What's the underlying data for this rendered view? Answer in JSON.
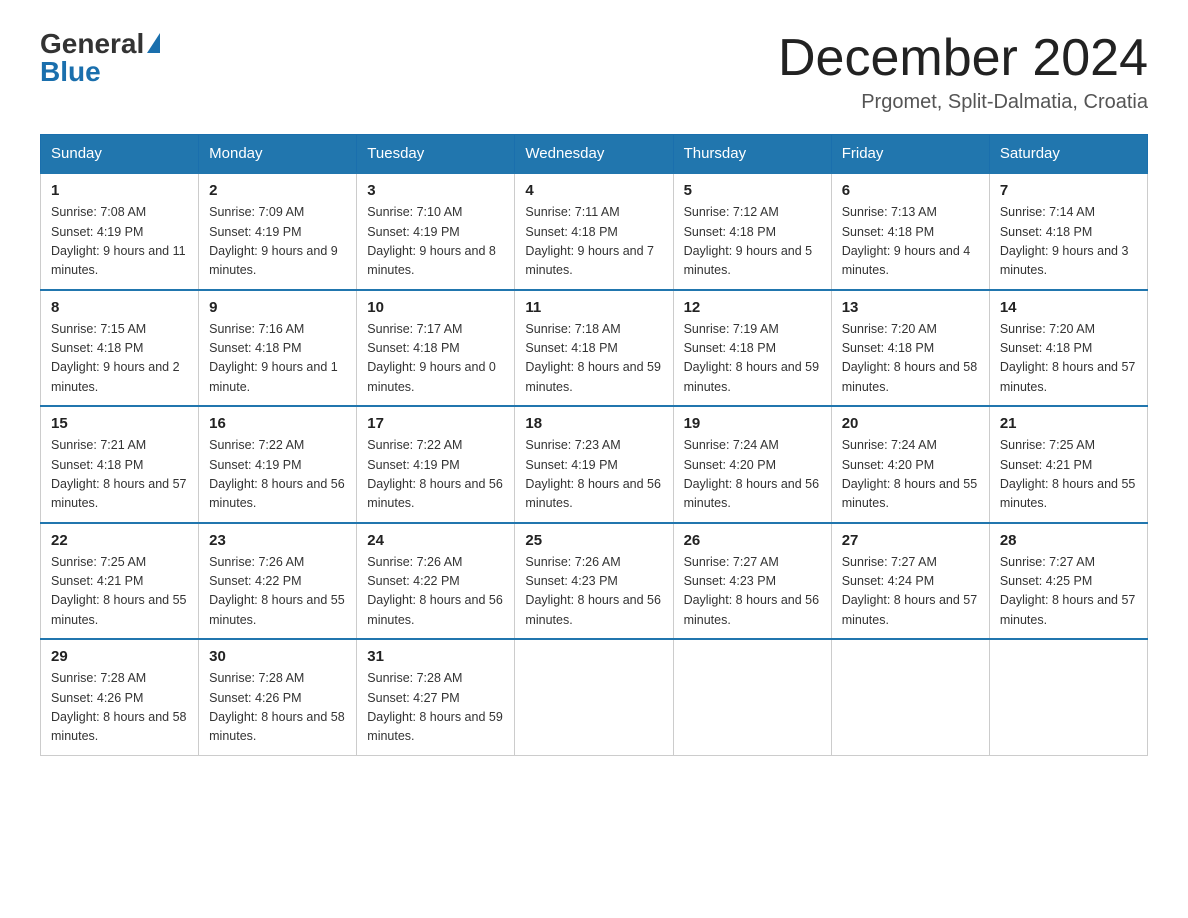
{
  "header": {
    "logo_general": "General",
    "logo_blue": "Blue",
    "month_year": "December 2024",
    "location": "Prgomet, Split-Dalmatia, Croatia"
  },
  "days_of_week": [
    "Sunday",
    "Monday",
    "Tuesday",
    "Wednesday",
    "Thursday",
    "Friday",
    "Saturday"
  ],
  "weeks": [
    [
      {
        "day": "1",
        "sunrise": "7:08 AM",
        "sunset": "4:19 PM",
        "daylight": "9 hours and 11 minutes."
      },
      {
        "day": "2",
        "sunrise": "7:09 AM",
        "sunset": "4:19 PM",
        "daylight": "9 hours and 9 minutes."
      },
      {
        "day": "3",
        "sunrise": "7:10 AM",
        "sunset": "4:19 PM",
        "daylight": "9 hours and 8 minutes."
      },
      {
        "day": "4",
        "sunrise": "7:11 AM",
        "sunset": "4:18 PM",
        "daylight": "9 hours and 7 minutes."
      },
      {
        "day": "5",
        "sunrise": "7:12 AM",
        "sunset": "4:18 PM",
        "daylight": "9 hours and 5 minutes."
      },
      {
        "day": "6",
        "sunrise": "7:13 AM",
        "sunset": "4:18 PM",
        "daylight": "9 hours and 4 minutes."
      },
      {
        "day": "7",
        "sunrise": "7:14 AM",
        "sunset": "4:18 PM",
        "daylight": "9 hours and 3 minutes."
      }
    ],
    [
      {
        "day": "8",
        "sunrise": "7:15 AM",
        "sunset": "4:18 PM",
        "daylight": "9 hours and 2 minutes."
      },
      {
        "day": "9",
        "sunrise": "7:16 AM",
        "sunset": "4:18 PM",
        "daylight": "9 hours and 1 minute."
      },
      {
        "day": "10",
        "sunrise": "7:17 AM",
        "sunset": "4:18 PM",
        "daylight": "9 hours and 0 minutes."
      },
      {
        "day": "11",
        "sunrise": "7:18 AM",
        "sunset": "4:18 PM",
        "daylight": "8 hours and 59 minutes."
      },
      {
        "day": "12",
        "sunrise": "7:19 AM",
        "sunset": "4:18 PM",
        "daylight": "8 hours and 59 minutes."
      },
      {
        "day": "13",
        "sunrise": "7:20 AM",
        "sunset": "4:18 PM",
        "daylight": "8 hours and 58 minutes."
      },
      {
        "day": "14",
        "sunrise": "7:20 AM",
        "sunset": "4:18 PM",
        "daylight": "8 hours and 57 minutes."
      }
    ],
    [
      {
        "day": "15",
        "sunrise": "7:21 AM",
        "sunset": "4:18 PM",
        "daylight": "8 hours and 57 minutes."
      },
      {
        "day": "16",
        "sunrise": "7:22 AM",
        "sunset": "4:19 PM",
        "daylight": "8 hours and 56 minutes."
      },
      {
        "day": "17",
        "sunrise": "7:22 AM",
        "sunset": "4:19 PM",
        "daylight": "8 hours and 56 minutes."
      },
      {
        "day": "18",
        "sunrise": "7:23 AM",
        "sunset": "4:19 PM",
        "daylight": "8 hours and 56 minutes."
      },
      {
        "day": "19",
        "sunrise": "7:24 AM",
        "sunset": "4:20 PM",
        "daylight": "8 hours and 56 minutes."
      },
      {
        "day": "20",
        "sunrise": "7:24 AM",
        "sunset": "4:20 PM",
        "daylight": "8 hours and 55 minutes."
      },
      {
        "day": "21",
        "sunrise": "7:25 AM",
        "sunset": "4:21 PM",
        "daylight": "8 hours and 55 minutes."
      }
    ],
    [
      {
        "day": "22",
        "sunrise": "7:25 AM",
        "sunset": "4:21 PM",
        "daylight": "8 hours and 55 minutes."
      },
      {
        "day": "23",
        "sunrise": "7:26 AM",
        "sunset": "4:22 PM",
        "daylight": "8 hours and 55 minutes."
      },
      {
        "day": "24",
        "sunrise": "7:26 AM",
        "sunset": "4:22 PM",
        "daylight": "8 hours and 56 minutes."
      },
      {
        "day": "25",
        "sunrise": "7:26 AM",
        "sunset": "4:23 PM",
        "daylight": "8 hours and 56 minutes."
      },
      {
        "day": "26",
        "sunrise": "7:27 AM",
        "sunset": "4:23 PM",
        "daylight": "8 hours and 56 minutes."
      },
      {
        "day": "27",
        "sunrise": "7:27 AM",
        "sunset": "4:24 PM",
        "daylight": "8 hours and 57 minutes."
      },
      {
        "day": "28",
        "sunrise": "7:27 AM",
        "sunset": "4:25 PM",
        "daylight": "8 hours and 57 minutes."
      }
    ],
    [
      {
        "day": "29",
        "sunrise": "7:28 AM",
        "sunset": "4:26 PM",
        "daylight": "8 hours and 58 minutes."
      },
      {
        "day": "30",
        "sunrise": "7:28 AM",
        "sunset": "4:26 PM",
        "daylight": "8 hours and 58 minutes."
      },
      {
        "day": "31",
        "sunrise": "7:28 AM",
        "sunset": "4:27 PM",
        "daylight": "8 hours and 59 minutes."
      },
      null,
      null,
      null,
      null
    ]
  ]
}
